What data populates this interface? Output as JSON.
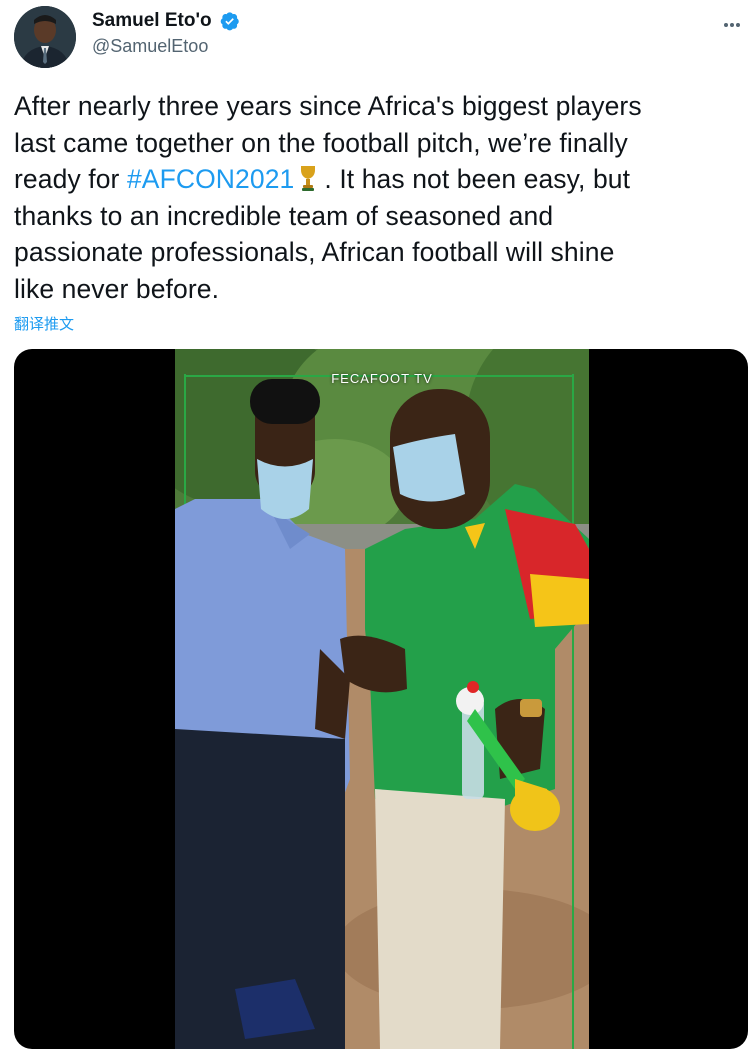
{
  "author": {
    "display_name": "Samuel Eto'o",
    "handle": "@SamuelEtoo",
    "verified": true
  },
  "tweet": {
    "lines": [
      [
        {
          "t": "After nearly three years since Africa's biggest players"
        }
      ],
      [
        {
          "t": "last came together on the football pitch, we’re finally"
        }
      ],
      [
        {
          "t": "ready for "
        },
        {
          "t": "#AFCON2021",
          "hashtag": true
        },
        {
          "t": "trophy",
          "icon": true
        },
        {
          "t": ". It has not been easy, but"
        }
      ],
      [
        {
          "t": "thanks to an incredible team of seasoned and"
        }
      ],
      [
        {
          "t": "passionate professionals, African football will shine"
        }
      ],
      [
        {
          "t": "like never before."
        }
      ]
    ],
    "translate_label": "翻译推文"
  },
  "media": {
    "watermark": "FECAFOOT TV"
  },
  "colors": {
    "link": "#1d9bf0",
    "text": "#0f1419",
    "secondary": "#536471"
  }
}
